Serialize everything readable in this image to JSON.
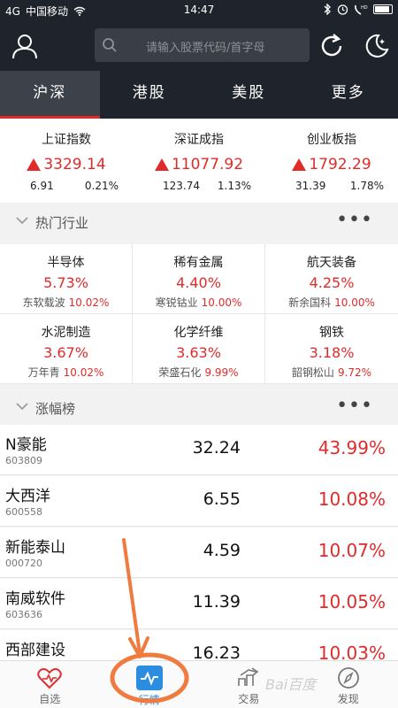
{
  "status_bar": {
    "carrier": "中国移动",
    "signal": "4G",
    "time": "14:47"
  },
  "search": {
    "placeholder": "请输入股票代码/首字母"
  },
  "tabs": [
    {
      "label": "沪深",
      "active": true
    },
    {
      "label": "港股"
    },
    {
      "label": "美股"
    },
    {
      "label": "更多"
    }
  ],
  "indices": [
    {
      "name": "上证指数",
      "value": "3329.14",
      "change": "6.91",
      "pct": "0.21%"
    },
    {
      "name": "深证成指",
      "value": "11077.92",
      "change": "123.74",
      "pct": "1.13%"
    },
    {
      "name": "创业板指",
      "value": "1792.29",
      "change": "31.39",
      "pct": "1.78%"
    }
  ],
  "hot_industry": {
    "title": "热门行业",
    "more": "•••",
    "items": [
      {
        "name": "半导体",
        "pct": "5.73%",
        "leader": "东软载波",
        "leader_pct": "10.02%"
      },
      {
        "name": "稀有金属",
        "pct": "4.40%",
        "leader": "寒锐钴业",
        "leader_pct": "10.00%"
      },
      {
        "name": "航天装备",
        "pct": "4.25%",
        "leader": "新余国科",
        "leader_pct": "10.00%"
      },
      {
        "name": "水泥制造",
        "pct": "3.67%",
        "leader": "万年青",
        "leader_pct": "10.02%"
      },
      {
        "name": "化学纤维",
        "pct": "3.63%",
        "leader": "荣盛石化",
        "leader_pct": "9.99%"
      },
      {
        "name": "钢铁",
        "pct": "3.18%",
        "leader": "韶钢松山",
        "leader_pct": "9.72%"
      }
    ]
  },
  "gainers": {
    "title": "涨幅榜",
    "more": "•••",
    "rows": [
      {
        "name": "N豪能",
        "code": "603809",
        "price": "32.24",
        "pct": "43.99%"
      },
      {
        "name": "大西洋",
        "code": "600558",
        "price": "6.55",
        "pct": "10.08%"
      },
      {
        "name": "新能泰山",
        "code": "000720",
        "price": "4.59",
        "pct": "10.07%"
      },
      {
        "name": "南威软件",
        "code": "603636",
        "price": "11.39",
        "pct": "10.05%"
      },
      {
        "name": "西部建设",
        "code": "",
        "price": "16.23",
        "pct": "10.03%"
      }
    ]
  },
  "bottom_nav": [
    {
      "label": "自选",
      "icon": "heart-chart-icon"
    },
    {
      "label": "行情",
      "icon": "pulse-chart-icon",
      "active": true
    },
    {
      "label": "交易",
      "icon": "trade-arrow-icon"
    },
    {
      "label": "发现",
      "icon": "compass-icon"
    }
  ],
  "colors": {
    "up": "#e12b2b",
    "header": "#1f242c",
    "accent": "#2b8de0",
    "annotation": "#f07b3f"
  },
  "watermark": "Bai百度"
}
